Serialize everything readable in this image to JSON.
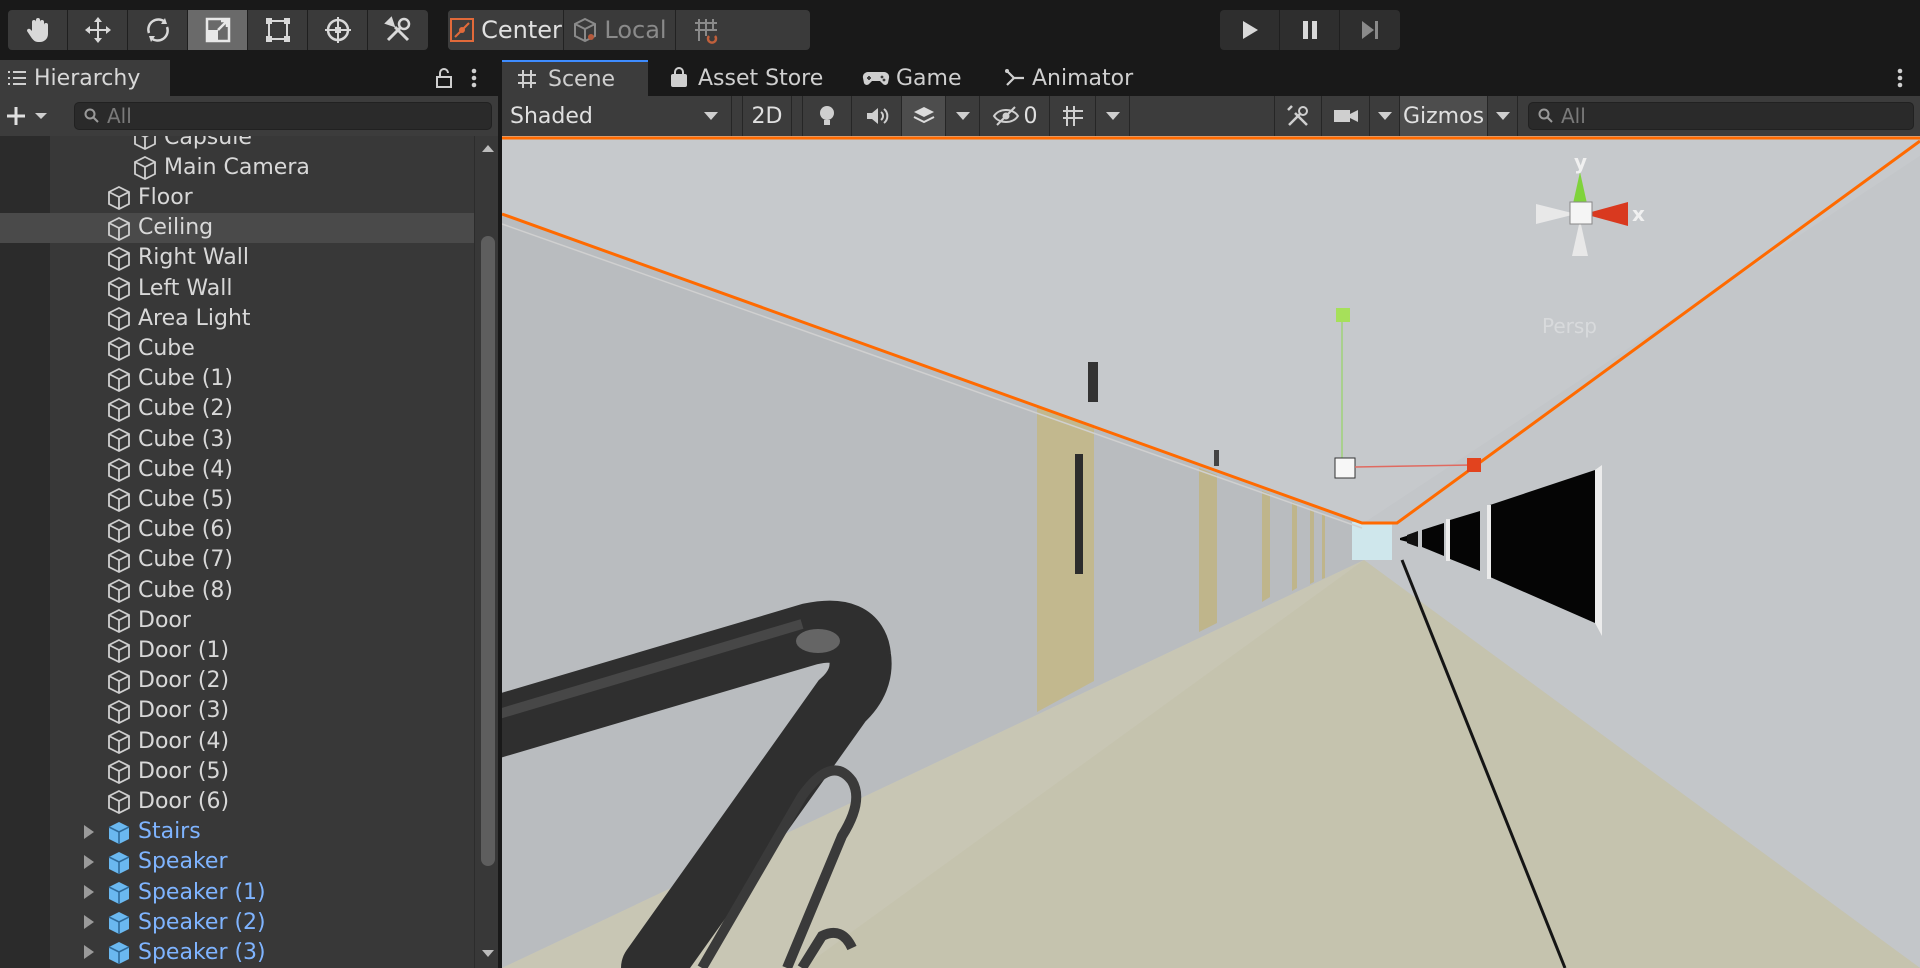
{
  "toolbar": {
    "tools": [
      "hand-tool",
      "move-tool",
      "rotate-tool",
      "scale-tool",
      "rect-tool",
      "transform-tool",
      "custom-editor-tool"
    ],
    "active_tool": "scale-tool",
    "pivot_label": "Center",
    "space_label": "Local",
    "snap_icon": "grid-snap-icon",
    "play_controls": [
      "play-icon",
      "pause-icon",
      "step-icon"
    ]
  },
  "hierarchy": {
    "title": "Hierarchy",
    "search_placeholder": "All",
    "items": [
      {
        "label": "Capsule",
        "indent": 2,
        "prefab": false,
        "expandable": false
      },
      {
        "label": "Main Camera",
        "indent": 2,
        "prefab": false,
        "expandable": false
      },
      {
        "label": "Floor",
        "indent": 1,
        "prefab": false,
        "expandable": false
      },
      {
        "label": "Ceiling",
        "indent": 1,
        "prefab": false,
        "expandable": false,
        "selected": true
      },
      {
        "label": "Right Wall",
        "indent": 1,
        "prefab": false,
        "expandable": false
      },
      {
        "label": "Left Wall",
        "indent": 1,
        "prefab": false,
        "expandable": false
      },
      {
        "label": "Area Light",
        "indent": 1,
        "prefab": false,
        "expandable": false
      },
      {
        "label": "Cube",
        "indent": 1,
        "prefab": false,
        "expandable": false
      },
      {
        "label": "Cube (1)",
        "indent": 1,
        "prefab": false,
        "expandable": false
      },
      {
        "label": "Cube (2)",
        "indent": 1,
        "prefab": false,
        "expandable": false
      },
      {
        "label": "Cube (3)",
        "indent": 1,
        "prefab": false,
        "expandable": false
      },
      {
        "label": "Cube (4)",
        "indent": 1,
        "prefab": false,
        "expandable": false
      },
      {
        "label": "Cube (5)",
        "indent": 1,
        "prefab": false,
        "expandable": false
      },
      {
        "label": "Cube (6)",
        "indent": 1,
        "prefab": false,
        "expandable": false
      },
      {
        "label": "Cube (7)",
        "indent": 1,
        "prefab": false,
        "expandable": false
      },
      {
        "label": "Cube (8)",
        "indent": 1,
        "prefab": false,
        "expandable": false
      },
      {
        "label": "Door",
        "indent": 1,
        "prefab": false,
        "expandable": false
      },
      {
        "label": "Door (1)",
        "indent": 1,
        "prefab": false,
        "expandable": false
      },
      {
        "label": "Door (2)",
        "indent": 1,
        "prefab": false,
        "expandable": false
      },
      {
        "label": "Door (3)",
        "indent": 1,
        "prefab": false,
        "expandable": false
      },
      {
        "label": "Door (4)",
        "indent": 1,
        "prefab": false,
        "expandable": false
      },
      {
        "label": "Door (5)",
        "indent": 1,
        "prefab": false,
        "expandable": false
      },
      {
        "label": "Door (6)",
        "indent": 1,
        "prefab": false,
        "expandable": false
      },
      {
        "label": "Stairs",
        "indent": 1,
        "prefab": true,
        "expandable": true
      },
      {
        "label": "Speaker",
        "indent": 1,
        "prefab": true,
        "expandable": true
      },
      {
        "label": "Speaker (1)",
        "indent": 1,
        "prefab": true,
        "expandable": true
      },
      {
        "label": "Speaker (2)",
        "indent": 1,
        "prefab": true,
        "expandable": true
      },
      {
        "label": "Speaker (3)",
        "indent": 1,
        "prefab": true,
        "expandable": true
      }
    ]
  },
  "scene": {
    "tabs": [
      {
        "label": "Scene",
        "icon": "grid-hash-icon"
      },
      {
        "label": "Asset Store",
        "icon": "shopping-bag-icon"
      },
      {
        "label": "Game",
        "icon": "gamepad-icon"
      },
      {
        "label": "Animator",
        "icon": "animator-icon"
      }
    ],
    "shading_mode": "Shaded",
    "mode_2d_label": "2D",
    "hidden_count": "0",
    "gizmos_label": "Gizmos",
    "search_placeholder": "All",
    "gizmo_axes": {
      "y": "y",
      "x": "x"
    },
    "perspective_label": "Persp"
  },
  "colors": {
    "accent_blue": "#3e8cff",
    "selection_orange": "#ff6a00",
    "prefab_blue": "#7fb4ff"
  }
}
